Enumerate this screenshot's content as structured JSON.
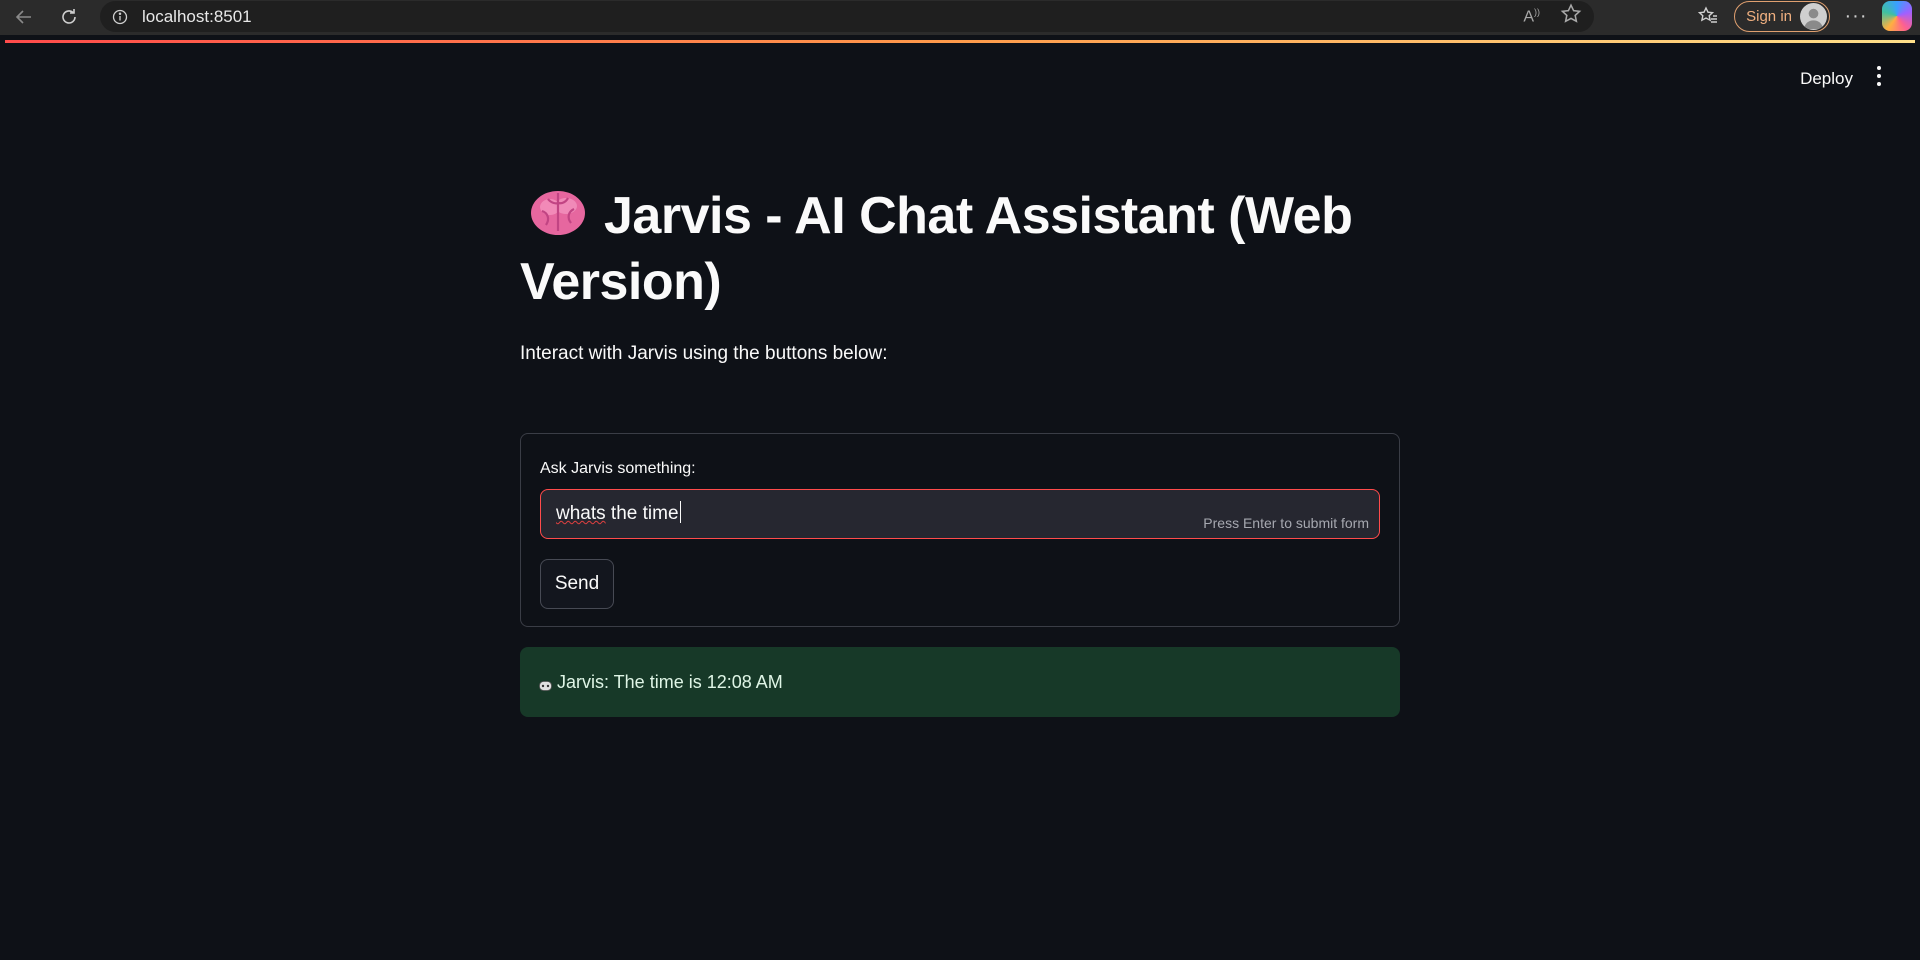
{
  "browser": {
    "url": "localhost:8501",
    "sign_in_label": "Sign in",
    "icons": [
      "back-icon",
      "reload-icon",
      "info-icon",
      "read-aloud-icon",
      "favorite-star-icon",
      "favorites-icon",
      "avatar-icon",
      "more-icon",
      "copilot-icon"
    ]
  },
  "app": {
    "deploy_label": "Deploy",
    "title_emoji": "brain-icon",
    "title_line1": "Jarvis - AI Chat Assistant (Web",
    "title_line2": "Version)",
    "subtitle": "Interact with Jarvis using the buttons below:",
    "form": {
      "label": "Ask Jarvis something:",
      "input_value_word1": "whats",
      "input_value_rest": " the time",
      "hint": "Press Enter to submit form",
      "send_label": "Send"
    },
    "response_text": "Jarvis: The time is 12:08 AM",
    "colors": {
      "background": "#0e1117",
      "accent": "#ff4b4b",
      "success_bg": "#173928"
    }
  }
}
